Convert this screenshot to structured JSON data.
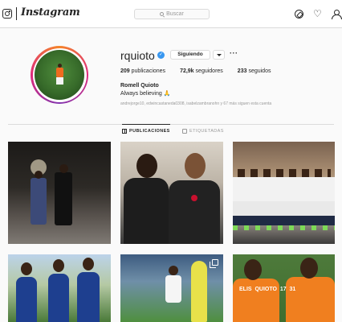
{
  "nav": {
    "brand": "Instagram",
    "search_placeholder": "Buscar",
    "icons": [
      "instagram-icon",
      "compass-icon",
      "heart-icon",
      "person-icon"
    ]
  },
  "profile": {
    "username": "rquioto",
    "verified": true,
    "follow_label": "Siguiendo",
    "stats": {
      "posts_count": "209",
      "posts_label": "publicaciones",
      "followers_count": "72,9k",
      "followers_label": "seguidores",
      "following_count": "233",
      "following_label": "seguidos"
    },
    "full_name": "Romell Quioto",
    "bio": "Always believing 🙏",
    "followed_by": "andrejorge10, edwincastaneda0308, isabelzambranohn y 67 más siguen esta cuenta"
  },
  "tabs": [
    {
      "label": "PUBLICACIONES",
      "active": true
    },
    {
      "label": "ETIQUETADAS",
      "active": false
    }
  ],
  "posts": [
    {
      "text": ""
    },
    {
      "text": ""
    },
    {
      "text": ""
    },
    {
      "text": ""
    },
    {
      "text": ""
    },
    {
      "text": "ELIS  QUIOTO  17  31"
    }
  ],
  "colors": {
    "accent_blue": "#3897f0",
    "border": "#dbdbdb",
    "text": "#262626",
    "muted": "#999999",
    "background": "#fafafa"
  }
}
